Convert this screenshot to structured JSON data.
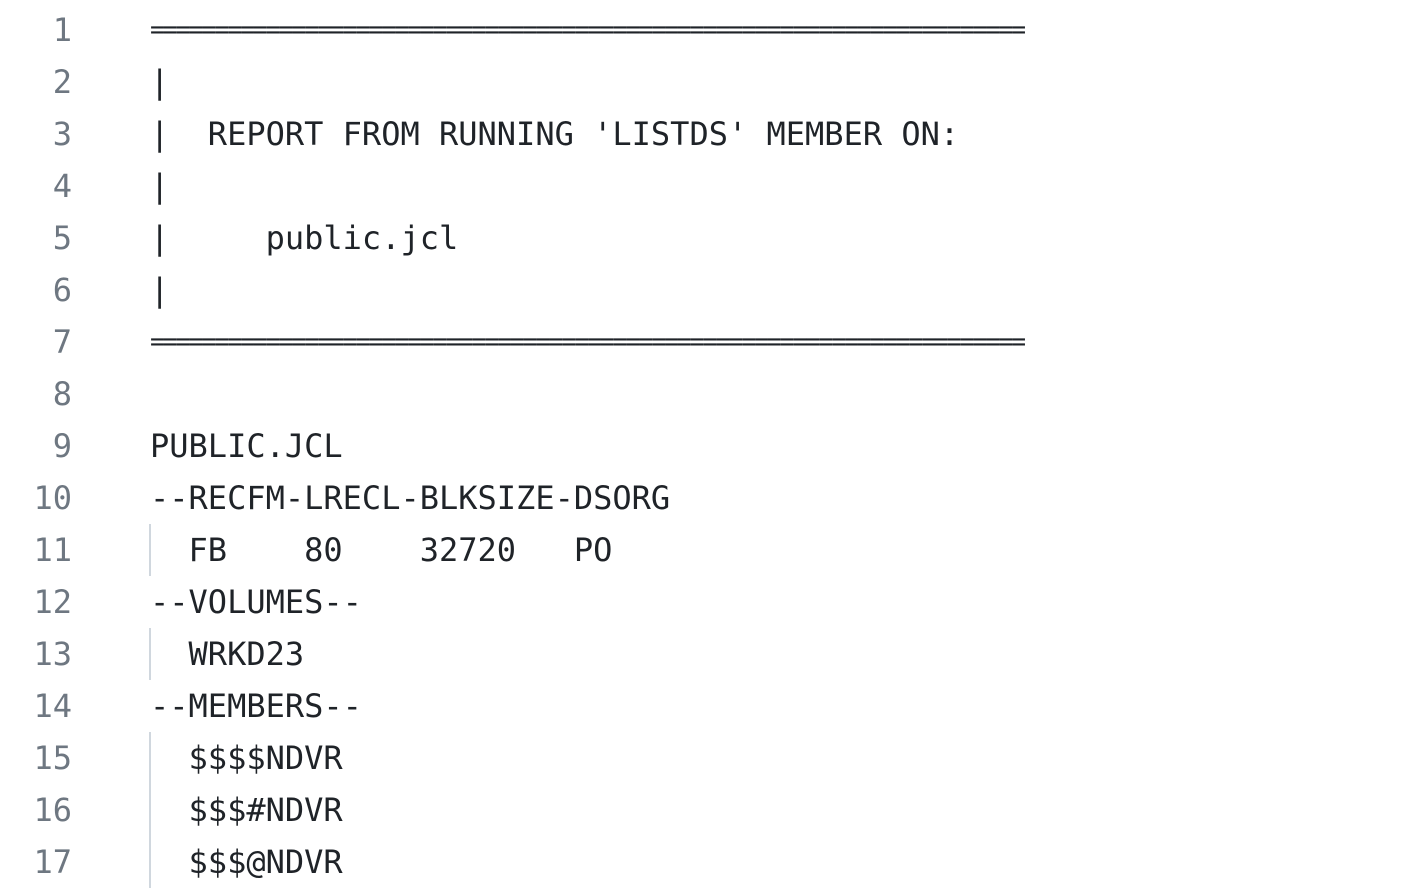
{
  "editor": {
    "lines": [
      {
        "number": "1",
        "text": "===================================================================="
      },
      {
        "number": "2",
        "text": "|"
      },
      {
        "number": "3",
        "text": "|  REPORT FROM RUNNING 'LISTDS' MEMBER ON:"
      },
      {
        "number": "4",
        "text": "|"
      },
      {
        "number": "5",
        "text": "|     public.jcl"
      },
      {
        "number": "6",
        "text": "|"
      },
      {
        "number": "7",
        "text": "===================================================================="
      },
      {
        "number": "8",
        "text": ""
      },
      {
        "number": "9",
        "text": "PUBLIC.JCL"
      },
      {
        "number": "10",
        "text": "--RECFM-LRECL-BLKSIZE-DSORG"
      },
      {
        "number": "11",
        "text": "  FB    80    32720   PO"
      },
      {
        "number": "12",
        "text": "--VOLUMES--"
      },
      {
        "number": "13",
        "text": "  WRKD23"
      },
      {
        "number": "14",
        "text": "--MEMBERS--"
      },
      {
        "number": "15",
        "text": "  $$$$NDVR"
      },
      {
        "number": "16",
        "text": "  $$$#NDVR"
      },
      {
        "number": "17",
        "text": "  $$$@NDVR"
      }
    ]
  },
  "colors": {
    "text": "#1f2328",
    "line_number": "#6e7781",
    "indent_guide": "#d0d7de",
    "background": "#ffffff"
  }
}
